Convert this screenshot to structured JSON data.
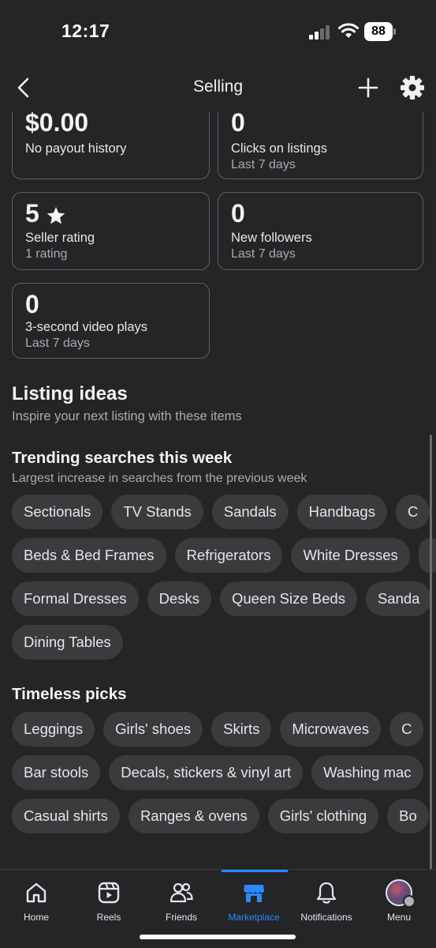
{
  "status_bar": {
    "time": "12:17",
    "battery": "88"
  },
  "header": {
    "title": "Selling"
  },
  "stats": [
    {
      "value": "$0.00",
      "label": "No payout history",
      "sub": ""
    },
    {
      "value": "0",
      "label": "Clicks on listings",
      "sub": "Last 7 days"
    },
    {
      "value": "5",
      "label": "Seller rating",
      "sub": "1 rating"
    },
    {
      "value": "0",
      "label": "New followers",
      "sub": "Last 7 days"
    },
    {
      "value": "0",
      "label": "3-second video plays",
      "sub": "Last 7 days"
    }
  ],
  "listing_ideas": {
    "title": "Listing ideas",
    "subtitle": "Inspire your next listing with these items"
  },
  "trending": {
    "title": "Trending searches this week",
    "subtitle": "Largest increase in searches from the previous week",
    "rows": [
      [
        "Sectionals",
        "TV Stands",
        "Sandals",
        "Handbags",
        "C"
      ],
      [
        "Beds & Bed Frames",
        "Refrigerators",
        "White Dresses",
        ""
      ],
      [
        "Formal Dresses",
        "Desks",
        "Queen Size Beds",
        "Sanda"
      ],
      [
        "Dining Tables"
      ]
    ]
  },
  "timeless": {
    "title": "Timeless picks",
    "rows": [
      [
        "Leggings",
        "Girls' shoes",
        "Skirts",
        "Microwaves",
        "C"
      ],
      [
        "Bar stools",
        "Decals, stickers & vinyl art",
        "Washing mac"
      ],
      [
        "Casual shirts",
        "Ranges & ovens",
        "Girls' clothing",
        "Bo"
      ]
    ]
  },
  "nav": [
    {
      "label": "Home",
      "icon": "home-icon"
    },
    {
      "label": "Reels",
      "icon": "reels-icon"
    },
    {
      "label": "Friends",
      "icon": "friends-icon"
    },
    {
      "label": "Marketplace",
      "icon": "marketplace-icon",
      "active": true
    },
    {
      "label": "Notifications",
      "icon": "bell-icon"
    },
    {
      "label": "Menu",
      "icon": "avatar"
    }
  ],
  "colors": {
    "background": "#242527",
    "chip": "#3a3b3d",
    "accent": "#2d88ff",
    "card_border": "#5e6066"
  }
}
